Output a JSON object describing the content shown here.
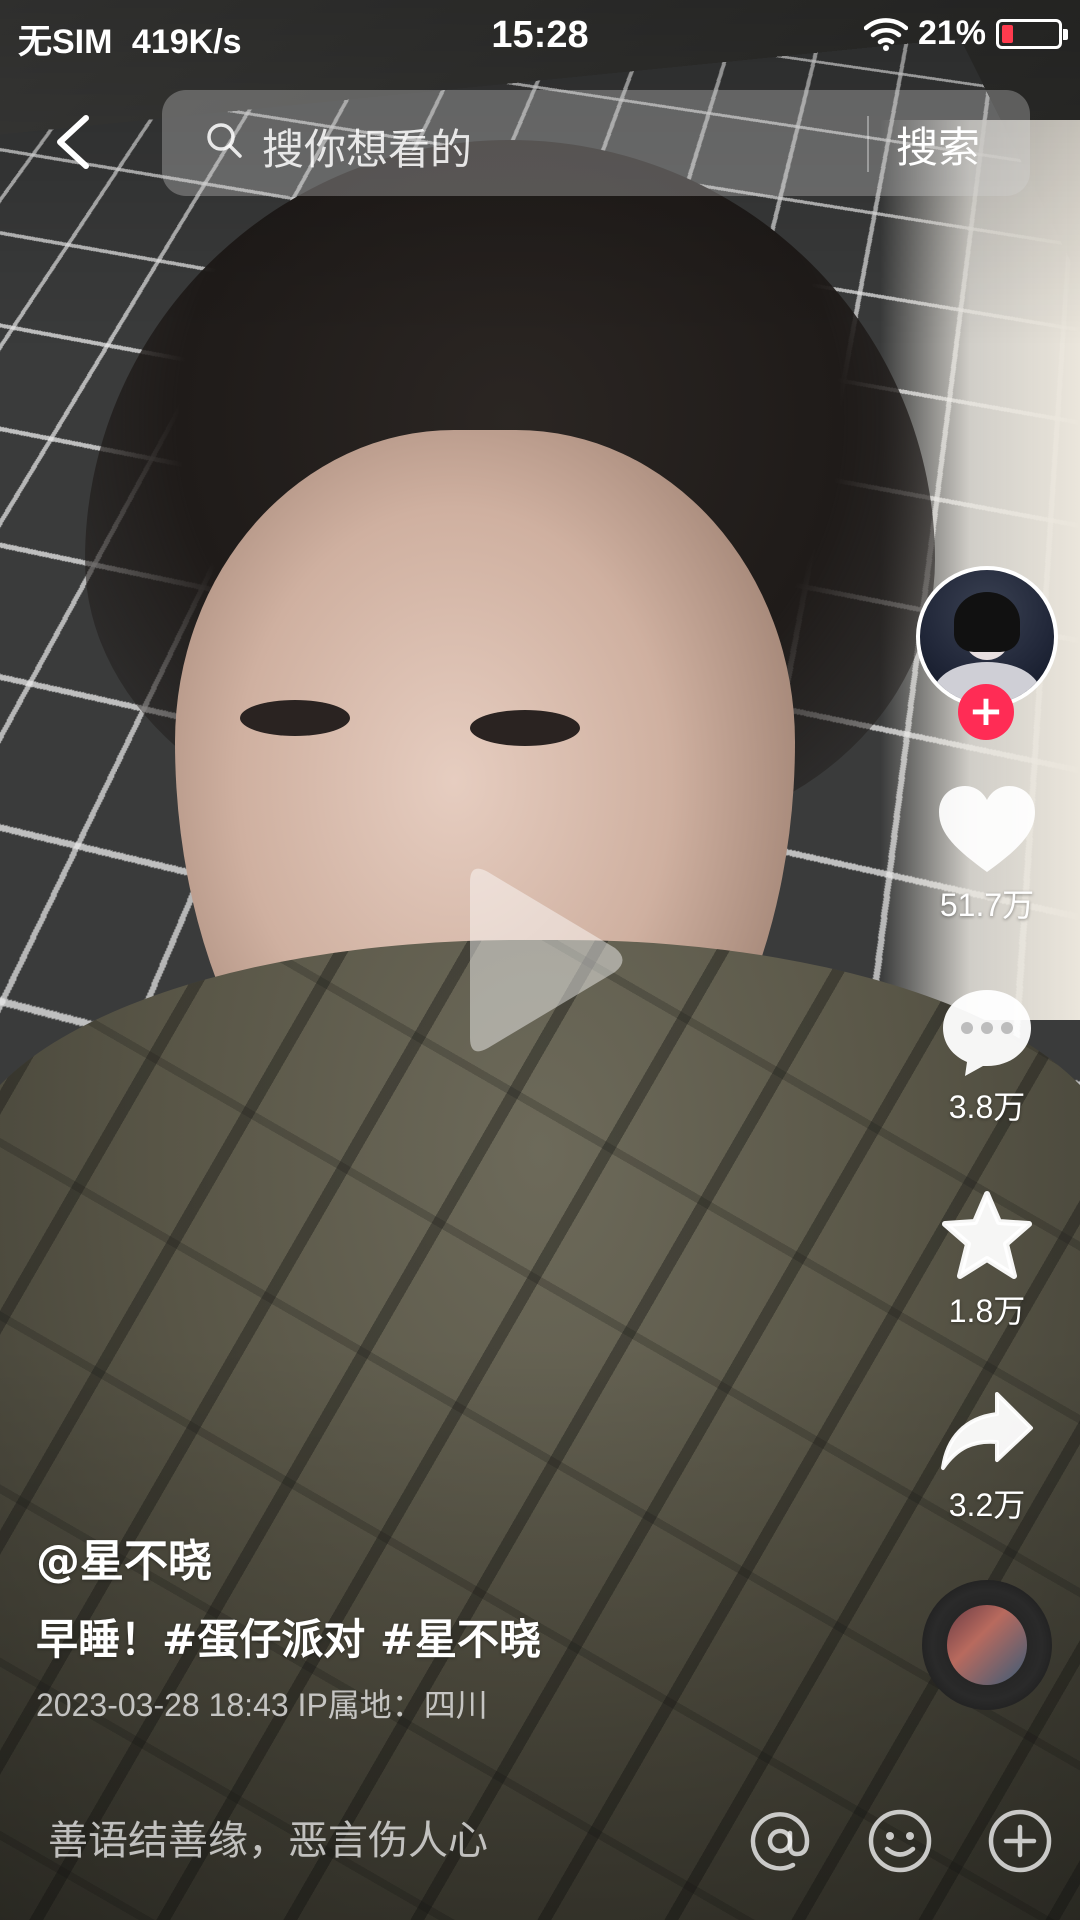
{
  "status_bar": {
    "carrier": "无SIM",
    "speed": "419K/s",
    "time": "15:28",
    "battery": "21%",
    "battery_level": 0.21,
    "battery_color": "#ff3b4e"
  },
  "search": {
    "placeholder": "搜你想看的",
    "button": "搜索",
    "back_icon": "chevron-left-icon",
    "search_icon": "magnifier-icon"
  },
  "video": {
    "play_icon": "play-icon"
  },
  "rail": {
    "avatar_icon": "avatar",
    "follow_icon": "plus-icon",
    "follow_color": "#ff2c55",
    "likes": "51.7万",
    "comments": "3.8万",
    "favorites": "1.8万",
    "shares": "3.2万",
    "music_icon": "music-disc-icon"
  },
  "caption": {
    "author": "@星不晓",
    "description": "早睡！#蛋仔派对 #星不晓",
    "meta": "2023-03-28 18:43  IP属地：四川"
  },
  "comment_bar": {
    "placeholder": "善语结善缘，恶言伤人心",
    "icons": [
      "at-icon",
      "emoji-icon",
      "plus-circle-icon"
    ]
  }
}
